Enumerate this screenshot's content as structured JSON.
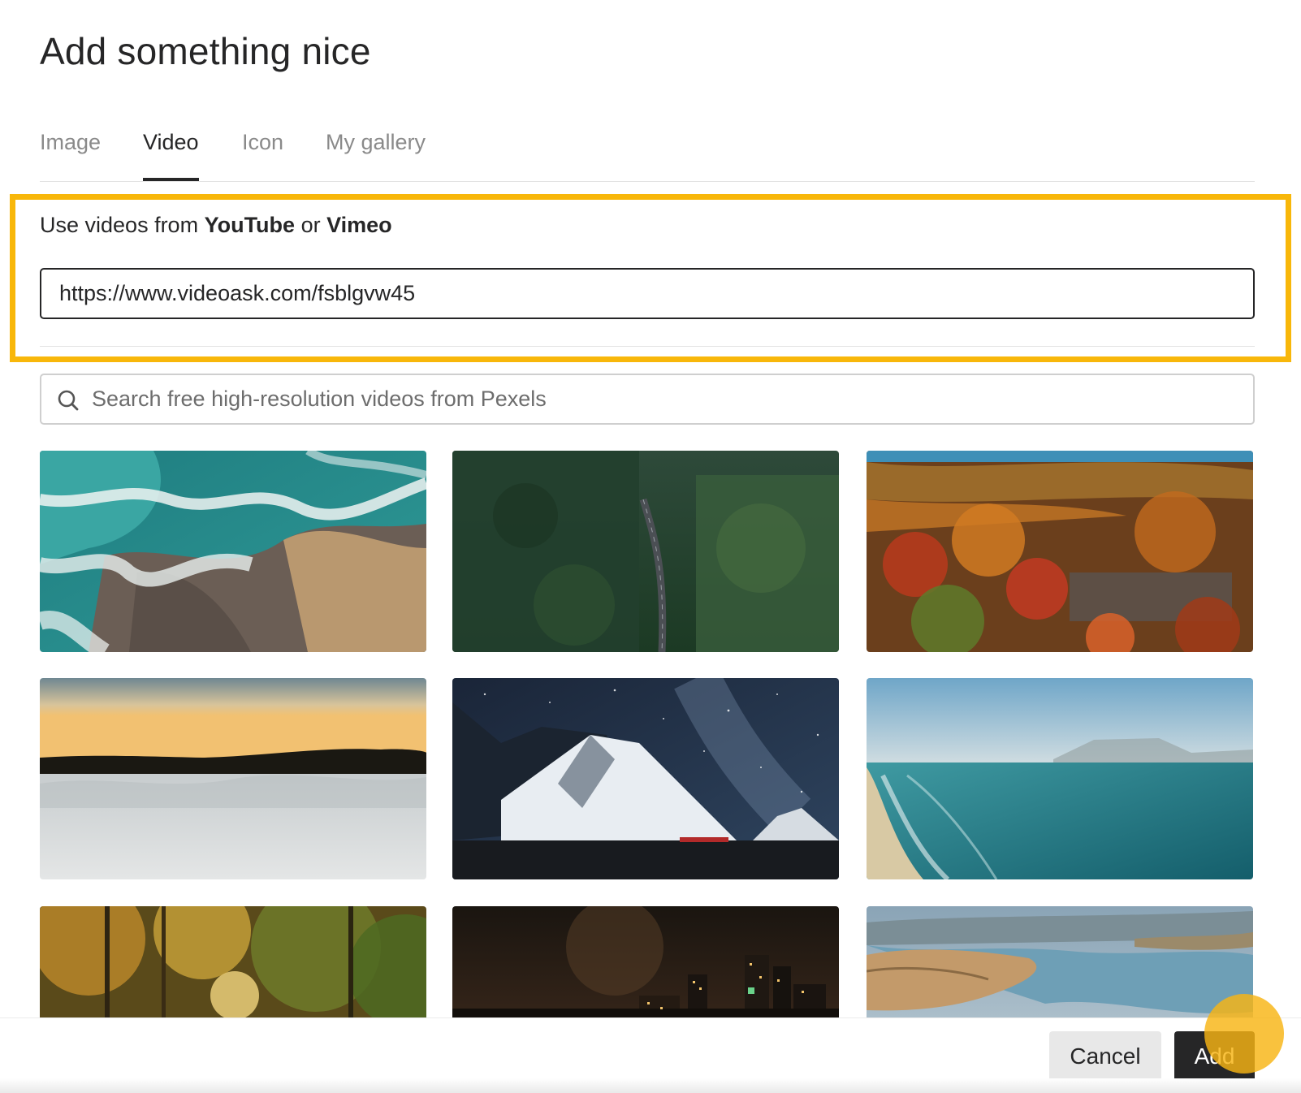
{
  "dialog": {
    "title": "Add something nice"
  },
  "tabs": [
    {
      "label": "Image",
      "active": false
    },
    {
      "label": "Video",
      "active": true
    },
    {
      "label": "Icon",
      "active": false
    },
    {
      "label": "My gallery",
      "active": false
    }
  ],
  "video_source": {
    "prefix": "Use videos from ",
    "youtube": "YouTube",
    "conjunction": " or ",
    "vimeo": "Vimeo",
    "url_value": "https://www.videoask.com/fsblgvw45"
  },
  "search": {
    "placeholder": "Search free high-resolution videos from Pexels",
    "icon": "search-icon"
  },
  "thumbnails": [
    {
      "name": "ocean-rocks-aerial"
    },
    {
      "name": "forest-road-aerial"
    },
    {
      "name": "autumn-cliffs-aerial"
    },
    {
      "name": "sunset-above-clouds"
    },
    {
      "name": "starry-mountain-night"
    },
    {
      "name": "coastline-beach"
    },
    {
      "name": "autumn-forest-path"
    },
    {
      "name": "city-skyline-night"
    },
    {
      "name": "river-canyon-aerial"
    }
  ],
  "footer": {
    "cancel_label": "Cancel",
    "add_label": "Add"
  },
  "colors": {
    "highlight": "#f8b70a",
    "primary_button": "#262627",
    "secondary_button": "#e8e8e8",
    "cursor_indicator": "#f8b414"
  }
}
